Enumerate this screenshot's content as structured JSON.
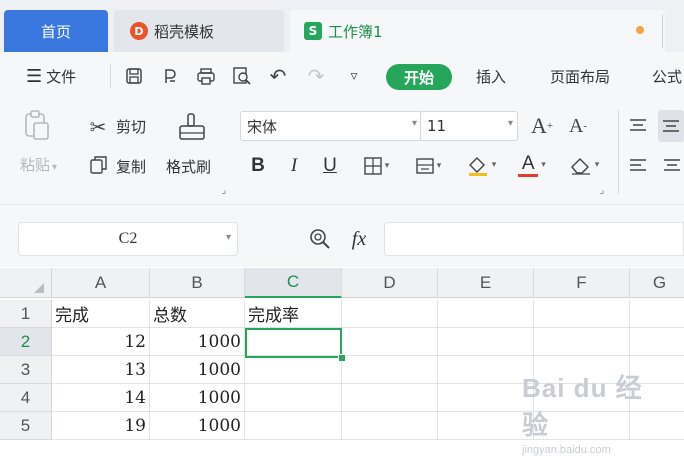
{
  "tabs": {
    "home": "首页",
    "wps": "稻壳模板",
    "workbook": "工作簿1",
    "wps_icon": "D",
    "workbook_icon": "S"
  },
  "menu": {
    "file": "文件",
    "start": "开始",
    "insert": "插入",
    "page_layout": "页面布局",
    "formula": "公式"
  },
  "ribbon": {
    "paste": "粘贴",
    "cut": "剪切",
    "copy": "复制",
    "format_painter": "格式刷",
    "font_name": "宋体",
    "font_size": "11",
    "bold": "B",
    "italic": "I",
    "underline": "U",
    "font_color": "A"
  },
  "formula_bar": {
    "cell_ref": "C2",
    "fx": "fx",
    "value": ""
  },
  "columns": [
    "A",
    "B",
    "C",
    "D",
    "E",
    "F",
    "G"
  ],
  "rows": [
    "1",
    "2",
    "3",
    "4",
    "5"
  ],
  "cells": {
    "A1": "完成",
    "B1": "总数",
    "C1": "完成率",
    "A2": "12",
    "B2": "1000",
    "A3": "13",
    "B3": "1000",
    "A4": "14",
    "B4": "1000",
    "A5": "19",
    "B5": "1000"
  },
  "watermark": {
    "text": "Bai du 经验",
    "url": "jingyan.baidu.com"
  },
  "colors": {
    "accent_green": "#26a65b",
    "home_tab_blue": "#3a78e0",
    "wps_red": "#e8542b"
  }
}
